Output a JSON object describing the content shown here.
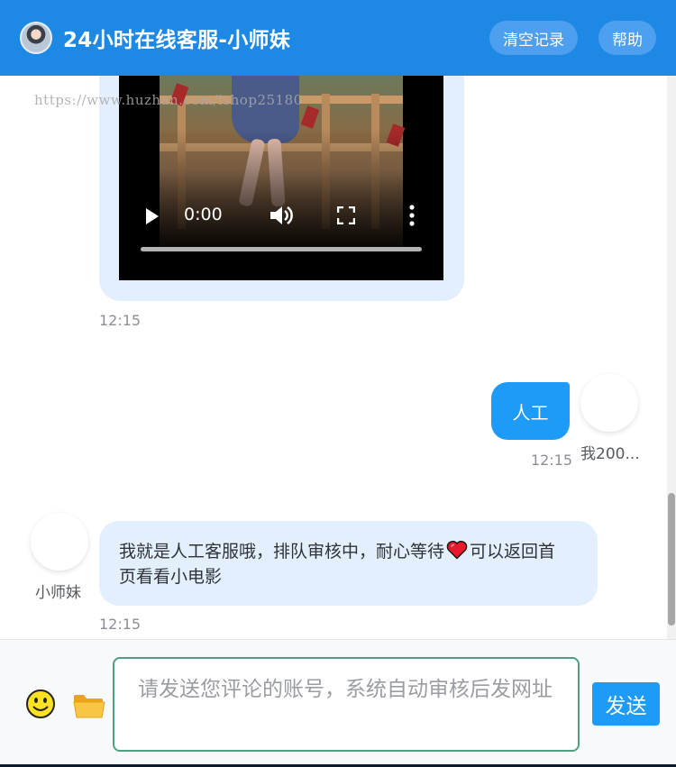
{
  "header": {
    "title": "24小时在线客服-小师妹",
    "clear_label": "清空记录",
    "help_label": "帮助"
  },
  "messages": {
    "watermark": "https://www.huzhan.com/ishop25180",
    "video": {
      "time": "0:00",
      "progress": 0
    },
    "video_timestamp": "12:15",
    "user_message": {
      "text": "人工",
      "timestamp": "12:15",
      "name": "我200..."
    },
    "agent_message": {
      "name": "小师妹",
      "text_before": "我就是人工客服哦，排队审核中，耐心等待",
      "text_after": "可以返回首页看看小电影",
      "timestamp": "12:15"
    }
  },
  "input": {
    "placeholder": "请发送您评论的账号，系统自动审核后发网址",
    "value": "",
    "send_label": "发送"
  },
  "icons": {
    "emoji": "smiley-face-icon",
    "folder": "folder-icon",
    "heart": "heart-icon"
  },
  "colors": {
    "header": "#1e88e5",
    "user_bubble": "#1e9bf7",
    "agent_bubble": "#e3effd",
    "send_button": "#1e9bf7",
    "input_border": "#4fa07e"
  }
}
